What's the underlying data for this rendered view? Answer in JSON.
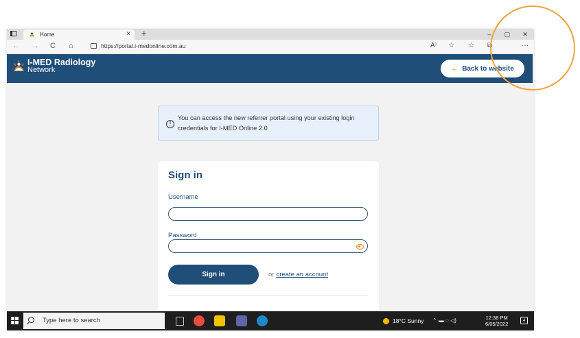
{
  "browser": {
    "tab_title": "Home",
    "tab_close": "×",
    "new_tab": "+",
    "url": "https://portal.i-medonline.com.au",
    "nav_back": "←",
    "nav_forward": "→",
    "nav_refresh": "C",
    "nav_home": "⌂",
    "read_aloud": "A⁾",
    "favorite_star": "☆",
    "favorites": "☆",
    "collections": "⧉",
    "more": "···",
    "win_min": "–",
    "win_max": "▢",
    "win_close": "✕"
  },
  "header": {
    "brand_line1": "I-MED Radiology",
    "brand_line2": "Network",
    "back_button": "Back to website",
    "back_arrow": "←",
    "color": "#1f4e79",
    "accent": "#f08a24"
  },
  "info": {
    "icon_char": "!",
    "message": "You can access the new referrer portal using your existing login credentials for I-MED Online 2.0"
  },
  "signin": {
    "title": "Sign in",
    "username_label": "Username",
    "username_value": "",
    "password_label": "Password",
    "password_value": "",
    "button": "Sign in",
    "or_text": "or",
    "create_link": "create an account"
  },
  "taskbar": {
    "search_placeholder": "Type here to search",
    "weather": "18°C  Sunny",
    "time": "12:38 PM",
    "date": "6/05/2022",
    "notifications": "4",
    "tray_icons": "⌃  ▬  ◌  ◁)"
  }
}
